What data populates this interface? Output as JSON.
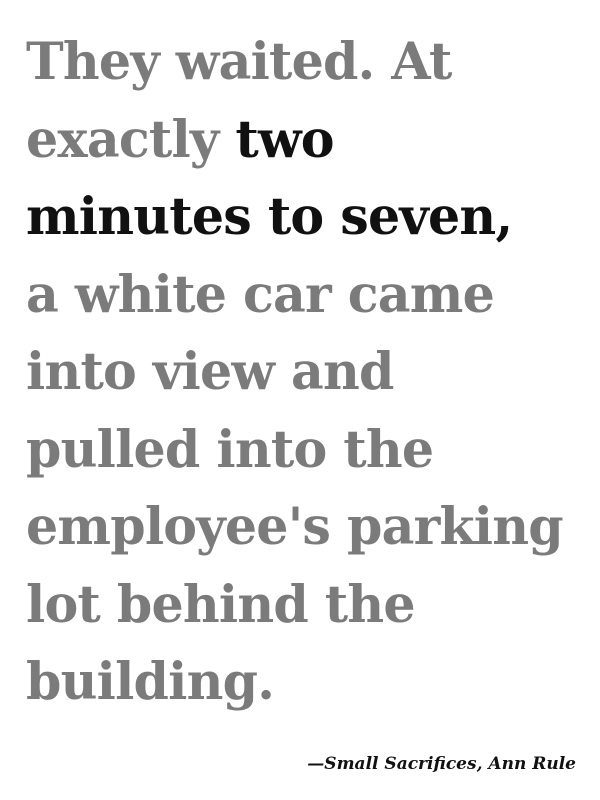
{
  "quote": {
    "lines": [
      {
        "segments": [
          {
            "text": "They waited. At",
            "style": "muted"
          }
        ]
      },
      {
        "segments": [
          {
            "text": "exactly ",
            "style": "muted"
          },
          {
            "text": "two",
            "style": "emphasis"
          }
        ]
      },
      {
        "segments": [
          {
            "text": "minutes to seven,",
            "style": "emphasis"
          }
        ]
      },
      {
        "segments": [
          {
            "text": "a white car came",
            "style": "muted"
          }
        ]
      },
      {
        "segments": [
          {
            "text": "into view and",
            "style": "muted"
          }
        ]
      },
      {
        "segments": [
          {
            "text": "pulled into the",
            "style": "muted"
          }
        ]
      },
      {
        "segments": [
          {
            "text": "employee's parking",
            "style": "muted"
          }
        ]
      },
      {
        "segments": [
          {
            "text": "lot behind the",
            "style": "muted"
          }
        ]
      },
      {
        "segments": [
          {
            "text": "building.",
            "style": "muted"
          }
        ]
      }
    ]
  },
  "attribution": "—Small Sacrifices, Ann Rule",
  "colors": {
    "muted_text": "#7b7b7b",
    "emphasis_text": "#111111",
    "background": "#ffffff"
  }
}
